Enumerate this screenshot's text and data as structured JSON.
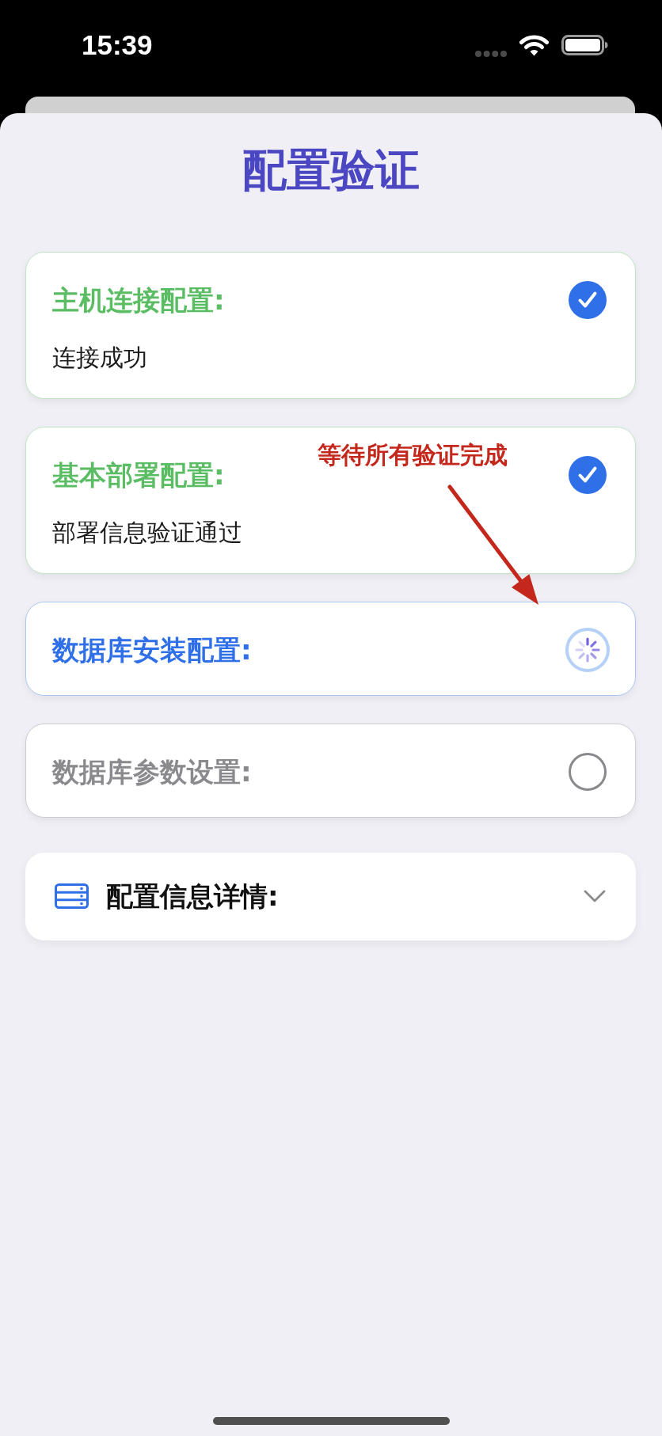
{
  "status_bar": {
    "time": "15:39"
  },
  "title": "配置验证",
  "checks": [
    {
      "title": "主机连接配置:",
      "detail": "连接成功",
      "done": true,
      "active": false
    },
    {
      "title": "基本部署配置:",
      "detail": "部署信息验证通过",
      "done": true,
      "active": false
    },
    {
      "title": "数据库安装配置:",
      "done": false,
      "active": true
    },
    {
      "title": "数据库参数设置:",
      "done": false,
      "active": false
    }
  ],
  "details_panel": {
    "title": "配置信息详情:",
    "expanded": false
  },
  "annotation": {
    "text": "等待所有验证完成"
  }
}
